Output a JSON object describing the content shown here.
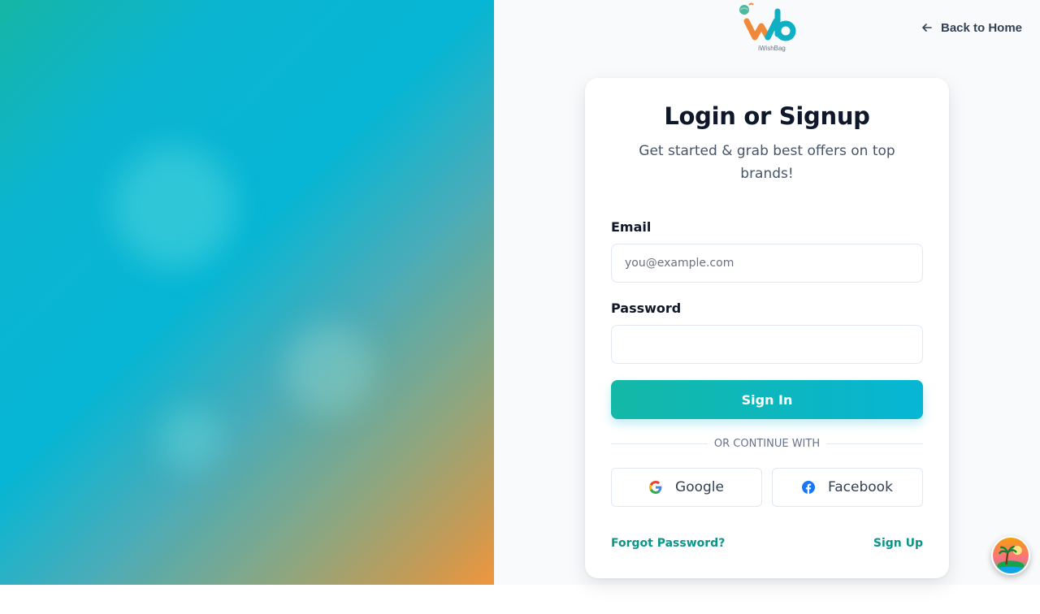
{
  "logo": {
    "caption": "iWishBag",
    "icon": "iwb-logo"
  },
  "nav": {
    "back_label": "Back to Home",
    "back_icon": "arrow-left-icon"
  },
  "login": {
    "title": "Login or Signup",
    "subtitle": "Get started & grab best offers on top brands!",
    "email_label": "Email",
    "email_placeholder": "you@example.com",
    "email_value": "",
    "password_label": "Password",
    "password_value": "",
    "signin_label": "Sign In",
    "divider_text": "OR CONTINUE WITH",
    "google_label": "Google",
    "facebook_label": "Facebook",
    "forgot_label": "Forgot Password?",
    "signup_label": "Sign Up"
  },
  "colors": {
    "accent": "#14b8a6",
    "accent_end": "#06b6d4",
    "link": "#0d9488",
    "hero_gradient": [
      "#16b5a5",
      "#06b6d4",
      "#f0963c"
    ]
  }
}
